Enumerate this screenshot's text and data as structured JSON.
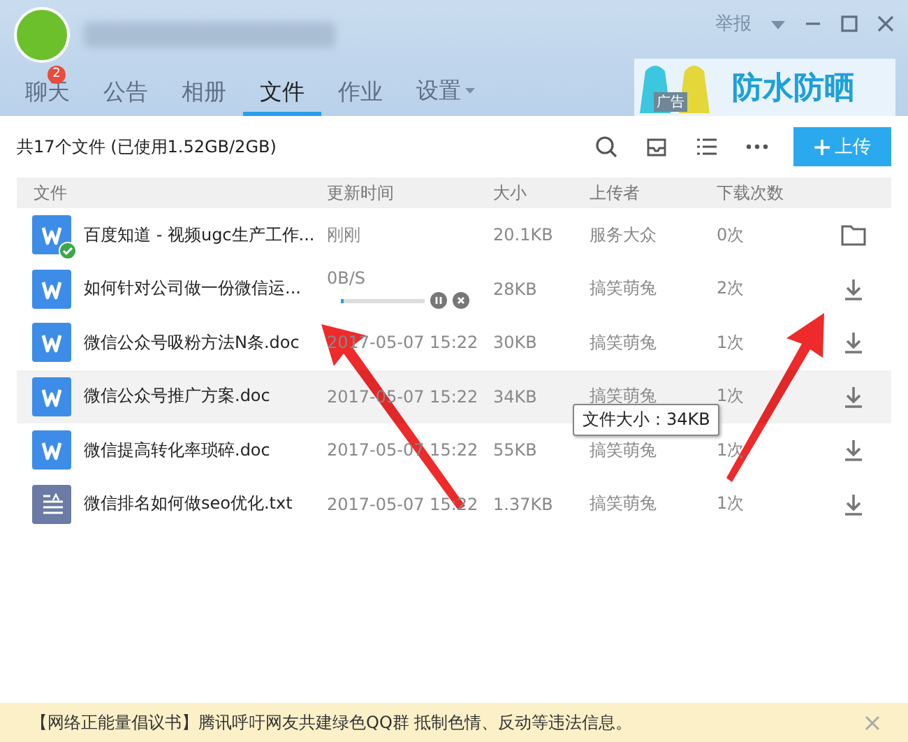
{
  "window": {
    "report": "举报"
  },
  "tabs": [
    {
      "label": "聊天",
      "badge": "2",
      "selected": false,
      "dropdown": false
    },
    {
      "label": "公告",
      "selected": false,
      "dropdown": false
    },
    {
      "label": "相册",
      "selected": false,
      "dropdown": false
    },
    {
      "label": "文件",
      "selected": true,
      "dropdown": false
    },
    {
      "label": "作业",
      "selected": false,
      "dropdown": false
    },
    {
      "label": "设置",
      "selected": false,
      "dropdown": true
    }
  ],
  "ad": {
    "tag": "广告",
    "text": "防水防晒"
  },
  "toolbar": {
    "summary": "共17个文件 (已使用1.52GB/2GB)",
    "upload": "上传"
  },
  "table": {
    "columns": [
      "文件",
      "更新时间",
      "大小",
      "上传者",
      "下载次数"
    ],
    "rows": [
      {
        "file_icon": {
          "kind": "word"
        },
        "verified": true,
        "name": "百度知道 - 视频ugc生产工作...",
        "time": "刚刚",
        "size": "20.1KB",
        "uploader": "服务大众",
        "downloads": "0次",
        "action_icon": {
          "kind": "folder"
        },
        "hovered": false
      },
      {
        "file_icon": {
          "kind": "word"
        },
        "verified": false,
        "name": "如何针对公司做一份微信运...",
        "transfer": {
          "speed": "0B/S",
          "level": 0.03
        },
        "size": "28KB",
        "uploader": "搞笑萌兔",
        "downloads": "2次",
        "action_icon": {
          "kind": "download"
        },
        "hovered": false
      },
      {
        "file_icon": {
          "kind": "word"
        },
        "verified": false,
        "name": "微信公众号吸粉方法N条.doc",
        "time": "2017-05-07 15:22",
        "size": "30KB",
        "uploader": "搞笑萌兔",
        "downloads": "1次",
        "action_icon": {
          "kind": "download"
        },
        "hovered": false
      },
      {
        "file_icon": {
          "kind": "word"
        },
        "verified": false,
        "name": "微信公众号推广方案.doc",
        "time": "2017-05-07 15:22",
        "size": "34KB",
        "uploader": "搞笑萌兔",
        "downloads": "1次",
        "action_icon": {
          "kind": "download"
        },
        "hovered": true
      },
      {
        "file_icon": {
          "kind": "word"
        },
        "verified": false,
        "name": "微信提高转化率琐碎.doc",
        "time": "2017-05-07 15:22",
        "size": "55KB",
        "uploader": "搞笑萌兔",
        "downloads": "1次",
        "action_icon": {
          "kind": "download"
        },
        "hovered": false
      },
      {
        "file_icon": {
          "kind": "text"
        },
        "verified": false,
        "name": "微信排名如何做seo优化.txt",
        "time": "2017-05-07 15:22",
        "size": "1.37KB",
        "uploader": "搞笑萌兔",
        "downloads": "1次",
        "action_icon": {
          "kind": "download"
        },
        "hovered": false
      }
    ]
  },
  "tooltip": "文件大小：34KB",
  "notice": "【网络正能量倡议书】腾讯呼吁网友共建绿色QQ群 抵制色情、反动等违法信息。"
}
